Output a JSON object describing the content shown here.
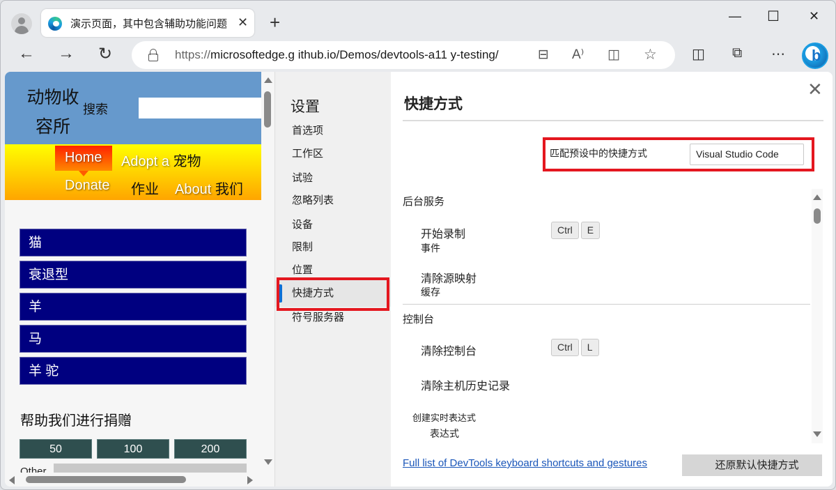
{
  "browser": {
    "tab_title": "演示页面，其中包含辅助功能问题",
    "tab_close": "✕",
    "new_tab": "+",
    "window_controls": {
      "minimize": "—",
      "maximize": "☐",
      "close": "✕"
    },
    "nav": {
      "back": "←",
      "forward": "→",
      "refresh": "↻"
    },
    "url_protocol": "https://",
    "url_rest": "microsoftedge.g ithub.io/Demos/devtools-a11 y-testing/",
    "address_icons": {
      "shopping": "⊟",
      "read_aloud": "A⁾",
      "immersive_reader": "◫",
      "favorite": "☆"
    },
    "toolbar_icons": {
      "split_screen": "◫",
      "collections": "⧉",
      "more": "⋯"
    },
    "bing_letter": "b"
  },
  "webpage": {
    "logo": "动物收容所",
    "search_label": "搜索",
    "search_value": "",
    "nav": {
      "home": "Home",
      "adopt_prefix": "Adopt a ",
      "adopt_cjk": "宠物",
      "donate": "Donate",
      "jobs_cjk": "作业",
      "about_prefix": "About ",
      "about_cjk": "我们"
    },
    "animals": [
      "猫",
      "衰退型",
      "羊",
      "马",
      "羊 驼"
    ],
    "donate_title": "帮助我们进行捐赠",
    "donate_amounts": [
      "50",
      "100",
      "200"
    ],
    "other_label": "Other"
  },
  "settings": {
    "title": "设置",
    "items": [
      {
        "label": "首选项",
        "active": false
      },
      {
        "label": "工作区",
        "active": false
      },
      {
        "label": "试验",
        "active": false
      },
      {
        "label": "忽略列表",
        "active": false
      },
      {
        "label": "设备",
        "active": false
      },
      {
        "label": "限制",
        "active": false
      },
      {
        "label": "位置",
        "active": false
      },
      {
        "label": "快捷方式",
        "active": true
      },
      {
        "label": "符号服务器",
        "active": false
      }
    ]
  },
  "shortcuts": {
    "title": "快捷方式",
    "close": "✕",
    "preset_label": "匹配预设中的快捷方式",
    "preset_value": "Visual Studio Code",
    "sections": [
      {
        "title": "后台服务",
        "actions": [
          {
            "name": "开始录制",
            "sub": "事件",
            "keys": [
              "Ctrl",
              "E"
            ]
          },
          {
            "name": "清除源映射",
            "sub": "缓存",
            "keys": []
          }
        ]
      },
      {
        "title": "控制台",
        "actions": [
          {
            "name": "清除控制台",
            "sub": "",
            "keys": [
              "Ctrl",
              "L"
            ]
          },
          {
            "name": "清除主机历史记录",
            "sub": "",
            "keys": []
          },
          {
            "name": "创建实时表达式",
            "sub": "表达式",
            "keys": []
          }
        ]
      }
    ],
    "footer_link": "Full list of DevTools keyboard shortcuts and gestures",
    "restore_button": "还原默认快捷方式"
  },
  "colors": {
    "highlight": "#e4171f",
    "active_indicator": "#0f6fd4",
    "site_header": "#6699cc",
    "animal_bg": "#000080",
    "donate_bg": "#2f4f4f"
  }
}
